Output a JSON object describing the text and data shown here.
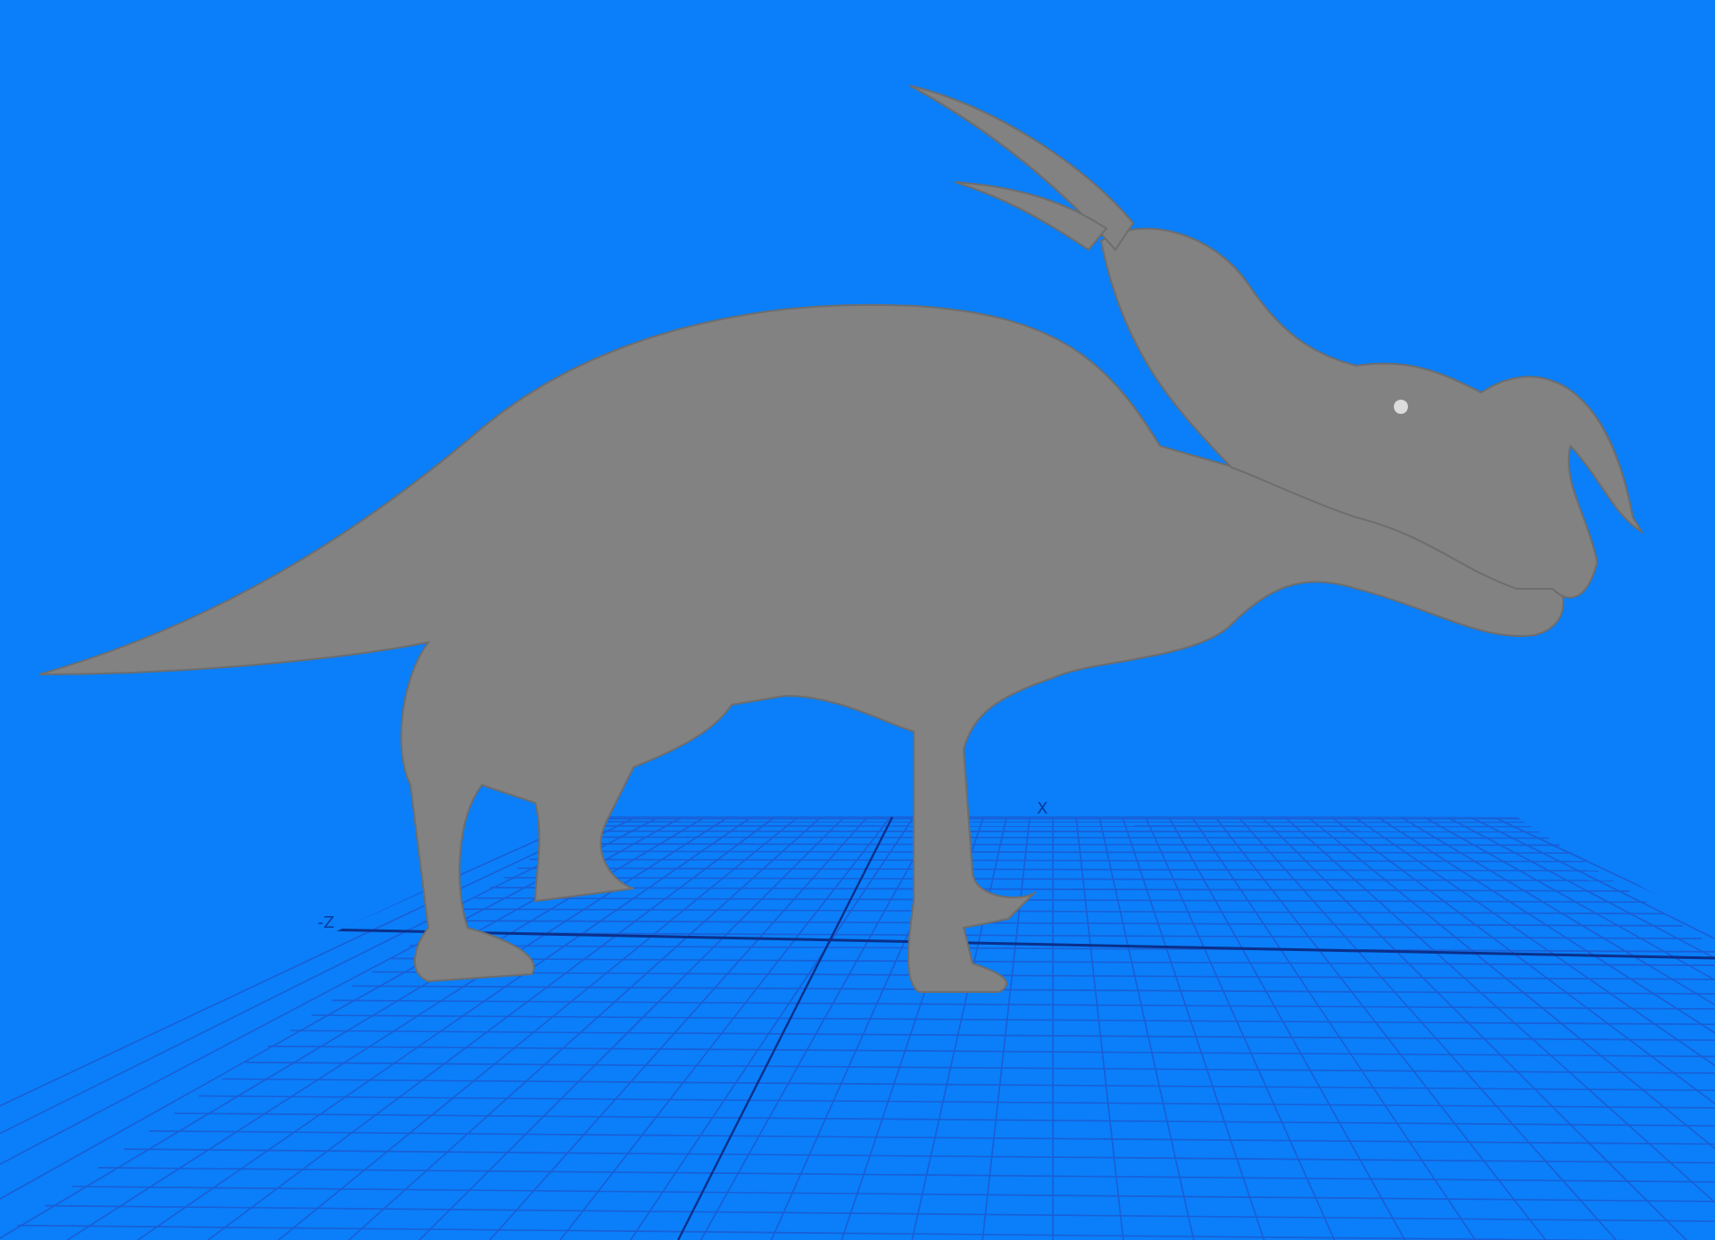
{
  "viewport": {
    "axis_labels": [
      "X",
      "-Z"
    ]
  }
}
